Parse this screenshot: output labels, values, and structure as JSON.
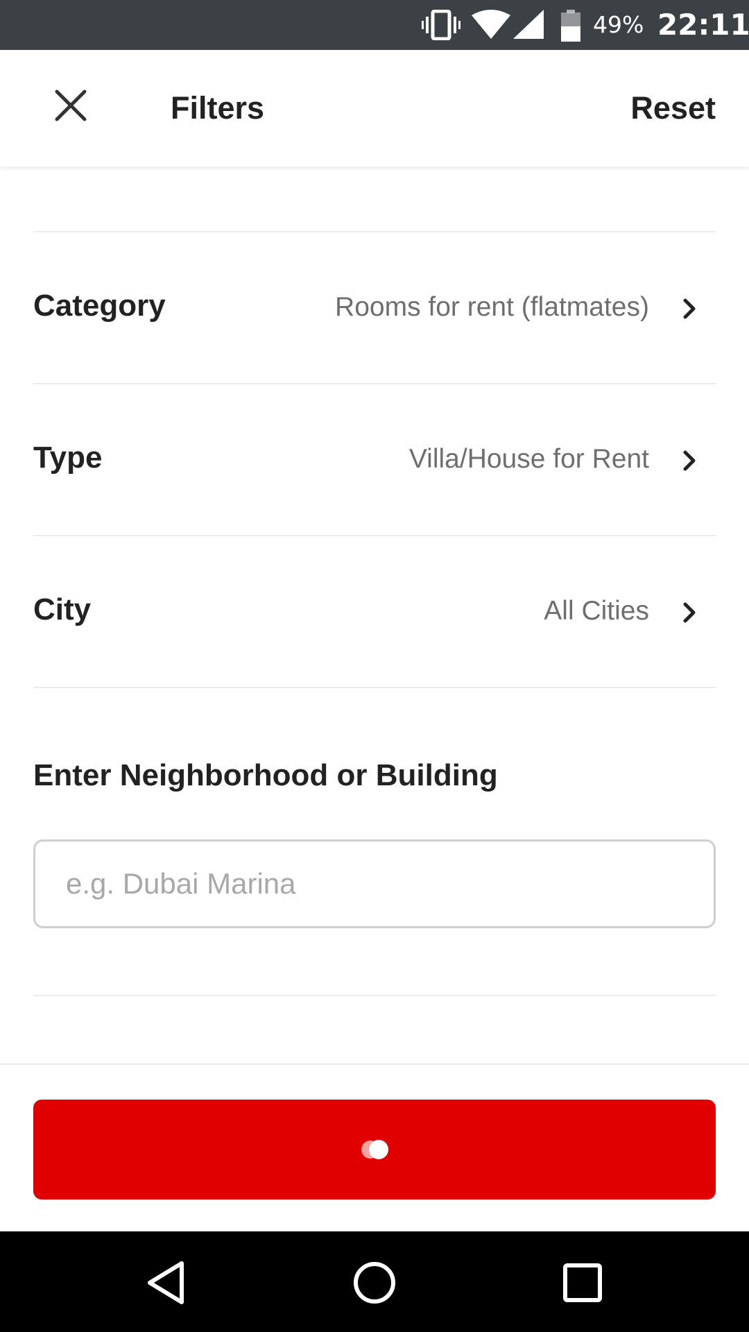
{
  "status_bar": {
    "battery_percent": "49%",
    "time": "22:11",
    "icons": [
      "vibrate-icon",
      "wifi-icon",
      "cell-signal-icon",
      "battery-icon"
    ]
  },
  "header": {
    "title": "Filters",
    "reset_label": "Reset",
    "close_icon": "close-icon"
  },
  "filters": {
    "category": {
      "label": "Category",
      "value": "Rooms for rent (flatmates)"
    },
    "type": {
      "label": "Type",
      "value": "Villa/House for Rent"
    },
    "city": {
      "label": "City",
      "value": "All Cities"
    }
  },
  "neighborhood": {
    "label": "Enter Neighborhood or Building",
    "placeholder": "e.g. Dubai Marina",
    "value": ""
  },
  "submit_button": {
    "state": "loading",
    "color": "#e00000"
  },
  "nav_bar": {
    "icons": [
      "back-icon",
      "home-icon",
      "recents-icon"
    ]
  }
}
